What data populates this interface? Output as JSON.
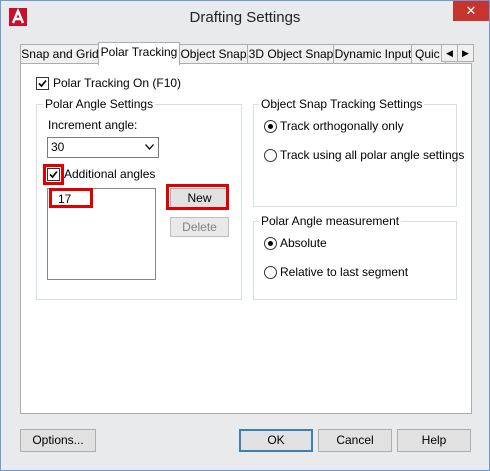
{
  "window": {
    "title": "Drafting Settings",
    "close_glyph": "✕",
    "app_icon": "autocad-logo-icon"
  },
  "tabs": [
    {
      "label": "Snap and Grid",
      "active": false
    },
    {
      "label": "Polar Tracking",
      "active": true
    },
    {
      "label": "Object Snap",
      "active": false
    },
    {
      "label": "3D Object Snap",
      "active": false
    },
    {
      "label": "Dynamic Input",
      "active": false
    },
    {
      "label": "Quic",
      "active": false
    }
  ],
  "tab_scroll": {
    "left": "◀",
    "right": "▶"
  },
  "polar_tracking_on": {
    "label": "Polar Tracking On (F10)",
    "checked": true
  },
  "polar_angle_settings": {
    "title": "Polar Angle Settings",
    "increment_label": "Increment angle:",
    "increment_value": "30",
    "additional_angles_label": "Additional angles",
    "additional_angles_checked": true,
    "angles": [
      "17"
    ],
    "new_button": "New",
    "delete_button": "Delete"
  },
  "object_snap_tracking": {
    "title": "Object Snap Tracking Settings",
    "options": [
      {
        "label": "Track orthogonally only",
        "selected": true
      },
      {
        "label": "Track using all polar angle settings",
        "selected": false
      }
    ]
  },
  "polar_angle_measurement": {
    "title": "Polar Angle measurement",
    "options": [
      {
        "label": "Absolute",
        "selected": true
      },
      {
        "label": "Relative to last segment",
        "selected": false
      }
    ]
  },
  "footer": {
    "options": "Options...",
    "ok": "OK",
    "cancel": "Cancel",
    "help": "Help"
  },
  "colors": {
    "highlight": "#e00000",
    "close": "#c7342d",
    "accent": "#3c7fb1"
  }
}
